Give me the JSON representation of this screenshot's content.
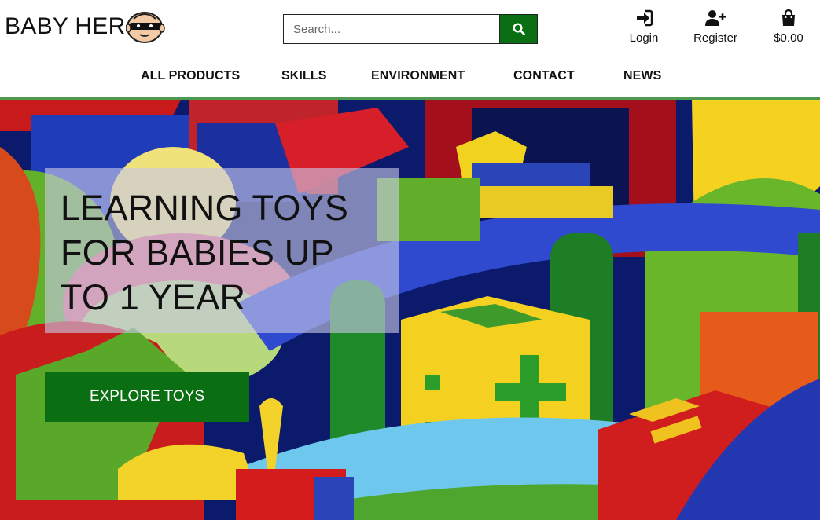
{
  "brand": {
    "name": "BABY HER",
    "logo_icon": "baby-hero-mask-face"
  },
  "search": {
    "placeholder": "Search...",
    "value": "",
    "button_icon": "search-icon"
  },
  "account": {
    "login_label": "Login",
    "register_label": "Register",
    "bag_total": "$0.00",
    "login_icon": "sign-in-icon",
    "register_icon": "user-plus-icon",
    "bag_icon": "shopping-bag-icon"
  },
  "nav": {
    "items": [
      {
        "label": "ALL PRODUCTS"
      },
      {
        "label": "SKILLS"
      },
      {
        "label": "ENVIRONMENT"
      },
      {
        "label": "CONTACT"
      },
      {
        "label": "NEWS"
      }
    ]
  },
  "hero": {
    "title": "LEARNING TOYS FOR BABIES UP TO 1 YEAR",
    "cta_label": "EXPLORE TOYS"
  },
  "colors": {
    "accent": "#0a6e12",
    "nav_divider": "#4c9a4f"
  }
}
